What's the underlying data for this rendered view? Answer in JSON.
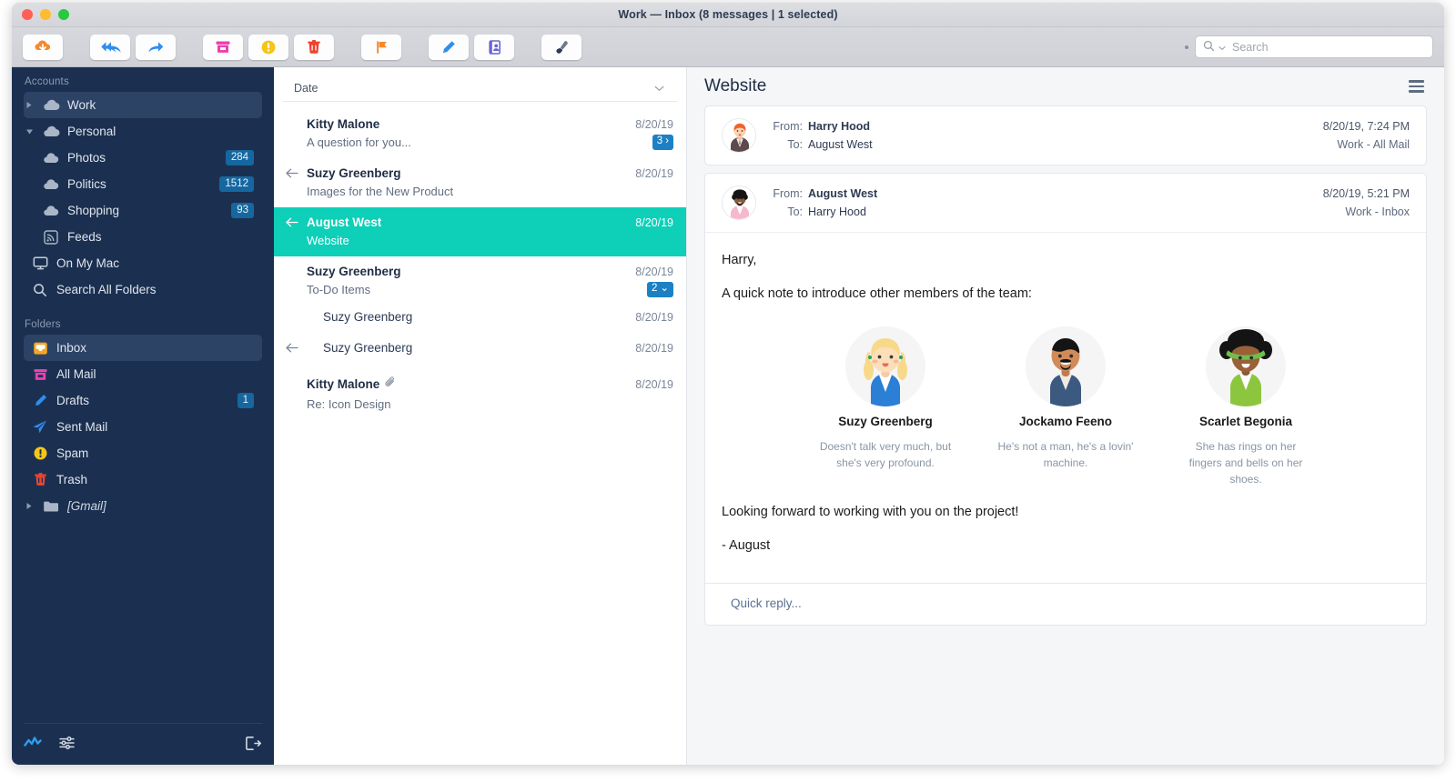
{
  "window": {
    "title": "Work — Inbox (8 messages | 1 selected)",
    "traffic_lights": [
      "close",
      "minimize",
      "zoom"
    ]
  },
  "toolbar": {
    "buttons": [
      {
        "name": "get-mail",
        "icon": "cloud-download-icon",
        "color": "#f5892b"
      },
      {
        "name": "reply-all",
        "icon": "reply-all-icon",
        "color": "#2f8ded"
      },
      {
        "name": "forward",
        "icon": "forward-arrow-icon",
        "color": "#2f8ded"
      },
      {
        "name": "archive",
        "icon": "archive-box-icon",
        "color": "#ec3fb0"
      },
      {
        "name": "junk",
        "icon": "exclamation-circle-icon",
        "color": "#f5c518"
      },
      {
        "name": "delete",
        "icon": "trash-icon",
        "color": "#f0412f"
      },
      {
        "name": "flag",
        "icon": "flag-icon",
        "color": "#f5892b"
      },
      {
        "name": "compose",
        "icon": "pencil-icon",
        "color": "#2f8ded"
      },
      {
        "name": "contacts",
        "icon": "address-book-icon",
        "color": "#6a62d6"
      },
      {
        "name": "customize",
        "icon": "paint-brush-icon",
        "color": "#3d4a5c"
      }
    ],
    "search": {
      "placeholder": "Search",
      "icon": "search-icon"
    }
  },
  "sidebar": {
    "accounts_header": "Accounts",
    "accounts": [
      {
        "label": "Work",
        "icon": "cloud-icon",
        "disclosure": "collapsed",
        "selected": true,
        "indent": 0
      },
      {
        "label": "Personal",
        "icon": "cloud-icon",
        "disclosure": "expanded",
        "selected": false,
        "indent": 0
      },
      {
        "label": "Photos",
        "icon": "cloud-icon",
        "badge": "284",
        "indent": 1
      },
      {
        "label": "Politics",
        "icon": "cloud-icon",
        "badge": "1512",
        "indent": 1
      },
      {
        "label": "Shopping",
        "icon": "cloud-icon",
        "badge": "93",
        "indent": 1
      },
      {
        "label": "Feeds",
        "icon": "rss-icon",
        "indent": 1
      },
      {
        "label": "On My Mac",
        "icon": "monitor-icon",
        "indent": 0
      },
      {
        "label": "Search All Folders",
        "icon": "search-icon",
        "indent": 0
      }
    ],
    "folders_header": "Folders",
    "folders": [
      {
        "label": "Inbox",
        "icon": "inbox-icon",
        "color": "#f5a623",
        "selected": true
      },
      {
        "label": "All Mail",
        "icon": "archive-box-icon",
        "color": "#ec3fb0"
      },
      {
        "label": "Drafts",
        "icon": "pencil-icon",
        "color": "#2f8ded",
        "badge": "1"
      },
      {
        "label": "Sent Mail",
        "icon": "paper-plane-icon",
        "color": "#2f8ded"
      },
      {
        "label": "Spam",
        "icon": "exclamation-circle-icon",
        "color": "#f5c518"
      },
      {
        "label": "Trash",
        "icon": "trash-icon",
        "color": "#f0412f"
      },
      {
        "label": "[Gmail]",
        "icon": "folder-icon",
        "disclosure": "collapsed",
        "italic": true
      }
    ],
    "footer": [
      {
        "name": "activity-icon"
      },
      {
        "name": "filter-sliders-icon"
      },
      {
        "name": "logout-icon"
      }
    ]
  },
  "message_list": {
    "sort_label": "Date",
    "sort_chevron": "chevron-down-icon",
    "rows": [
      {
        "from": "Kitty Malone",
        "subject": "A question for you...",
        "date": "8/20/19",
        "unread": true,
        "replied": false,
        "thread_count": "3",
        "thread_chevron": "›",
        "selected": false,
        "indent": 0,
        "attachment": false
      },
      {
        "from": "Suzy Greenberg",
        "subject": "Images for the New Product",
        "date": "8/20/19",
        "unread": true,
        "replied": true,
        "selected": false,
        "indent": 0,
        "attachment": false
      },
      {
        "from": "August West",
        "subject": "Website",
        "date": "8/20/19",
        "unread": false,
        "replied": true,
        "selected": true,
        "indent": 0,
        "attachment": false
      },
      {
        "from": "Suzy Greenberg",
        "subject": "To-Do Items",
        "date": "8/20/19",
        "unread": true,
        "replied": false,
        "thread_count": "2",
        "thread_chevron": "⌄",
        "selected": false,
        "indent": 0,
        "attachment": false
      },
      {
        "from": "Suzy Greenberg",
        "subject": "",
        "date": "8/20/19",
        "unread": false,
        "replied": false,
        "selected": false,
        "indent": 1,
        "attachment": false
      },
      {
        "from": "Suzy Greenberg",
        "subject": "",
        "date": "8/20/19",
        "unread": false,
        "replied": true,
        "selected": false,
        "indent": 1,
        "attachment": false
      },
      {
        "from": "Kitty Malone",
        "subject": "Re: Icon Design",
        "date": "8/20/19",
        "unread": true,
        "replied": false,
        "selected": false,
        "indent": 0,
        "attachment": true
      }
    ]
  },
  "reader": {
    "title": "Website",
    "menu_icon": "hamburger-menu-icon",
    "labels": {
      "from": "From:",
      "to": "To:"
    },
    "messages": [
      {
        "avatar": "harry-hood-avatar",
        "from": "Harry Hood",
        "to": "August West",
        "timestamp": "8/20/19, 7:24 PM",
        "mailbox": "Work - All Mail",
        "expanded": false
      },
      {
        "avatar": "august-west-avatar",
        "from": "August West",
        "to": "Harry Hood",
        "timestamp": "8/20/19, 5:21 PM",
        "mailbox": "Work - Inbox",
        "expanded": true,
        "body": {
          "greeting": "Harry,",
          "intro": "A quick note to introduce other members of the team:",
          "team": [
            {
              "name": "Suzy Greenberg",
              "desc": "Doesn't talk very much, but she's very profound.",
              "avatar": "suzy-greenberg-avatar"
            },
            {
              "name": "Jockamo Feeno",
              "desc": "He's not a man, he's a lovin' machine.",
              "avatar": "jockamo-feeno-avatar"
            },
            {
              "name": "Scarlet Begonia",
              "desc": "She has rings on her fingers and bells on her shoes.",
              "avatar": "scarlet-begonia-avatar"
            }
          ],
          "closing": "Looking forward to working with you on the project!",
          "signature": "- August"
        },
        "quick_reply": "Quick reply..."
      }
    ]
  },
  "colors": {
    "sidebar_bg": "#1b3050",
    "selection_teal": "#0ecfb8",
    "badge_blue": "#1667a0",
    "thread_badge_blue": "#1b81c4"
  }
}
